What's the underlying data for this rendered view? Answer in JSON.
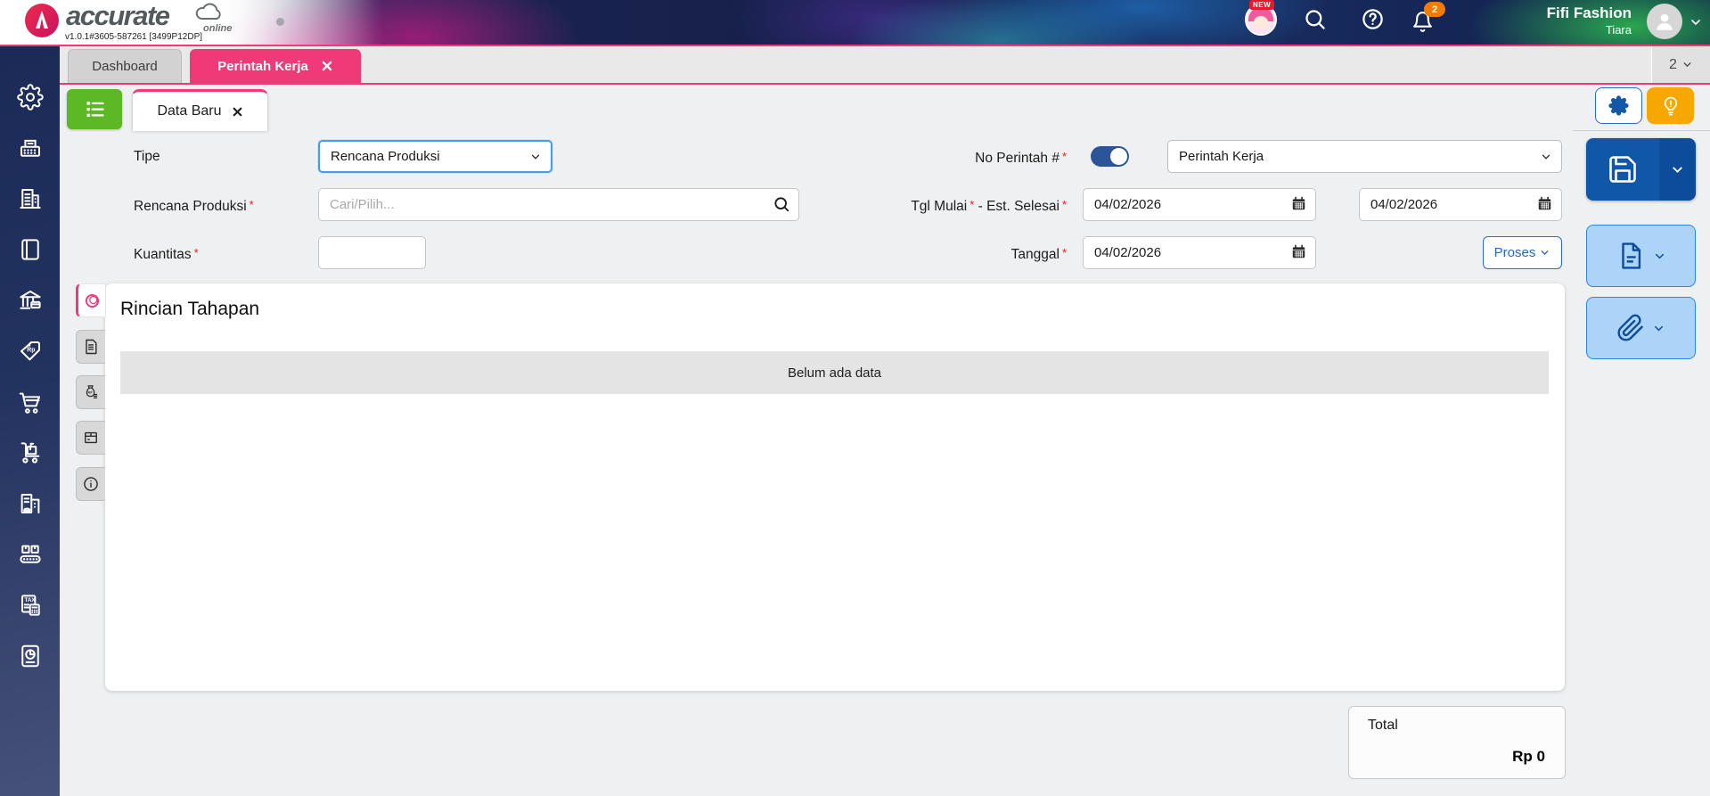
{
  "header": {
    "logo": {
      "brand": "accurate",
      "sub": "online"
    },
    "version": "v1.0.1#3605-587261 [3499P12DP]",
    "new_badge": "NEW",
    "notification_count": "2",
    "user": {
      "name": "Fifi Fashion",
      "company": "Tiara"
    },
    "icons": [
      "whats-new-avatar",
      "search",
      "help",
      "notification-bell",
      "user-avatar",
      "chevron-down"
    ]
  },
  "tabbar": {
    "dashboard_tab": "Dashboard",
    "active_tab": "Perintah Kerja",
    "overflow_count": "2"
  },
  "sidebar": {
    "icons": [
      "settings",
      "sales-register",
      "company",
      "journal",
      "banking",
      "price-rp",
      "purchase-cart",
      "inventory-trolley",
      "fixed-assets",
      "manufacturing",
      "tax",
      "reports"
    ]
  },
  "toolbar": {
    "list_button_icon": "list",
    "data_baru_tab": "Data Baru",
    "settings_icon": "gear",
    "tips_icon": "lightbulb"
  },
  "form": {
    "required_marker": "*",
    "tipe": {
      "label": "Tipe",
      "value": "Rencana Produksi"
    },
    "rencana_produksi": {
      "label": "Rencana Produksi",
      "placeholder": "Cari/Pilih..."
    },
    "kuantitas": {
      "label": "Kuantitas",
      "value": ""
    },
    "no_perintah": {
      "label": "No Perintah #",
      "toggle_state": "on",
      "type_value": "Perintah Kerja"
    },
    "tanggal_range": {
      "label_start": "Tgl Mulai",
      "separator": "-",
      "label_end": "Est. Selesai",
      "start_value": "04/02/2026",
      "end_value": "04/02/2026"
    },
    "tanggal": {
      "label": "Tanggal",
      "value": "04/02/2026"
    },
    "proses_button": "Proses"
  },
  "side_tabs": {
    "icons": [
      "stage-rings",
      "document",
      "cost-rp",
      "item-box",
      "info"
    ]
  },
  "detail_section": {
    "title": "Rincian Tahapan",
    "empty_message": "Belum ada data"
  },
  "total": {
    "label": "Total",
    "value": "Rp 0"
  },
  "actions": {
    "save_icon": "floppy-disk",
    "print_icon": "document",
    "attachment_icon": "paperclip"
  },
  "colors": {
    "accent_pink": "#ee3a76",
    "primary_blue": "#1157a7",
    "light_blue": "#abd4f8",
    "green": "#5cb824",
    "orange": "#f7a800",
    "toggle_blue": "#2d5496",
    "header_navy": "#141f47"
  }
}
